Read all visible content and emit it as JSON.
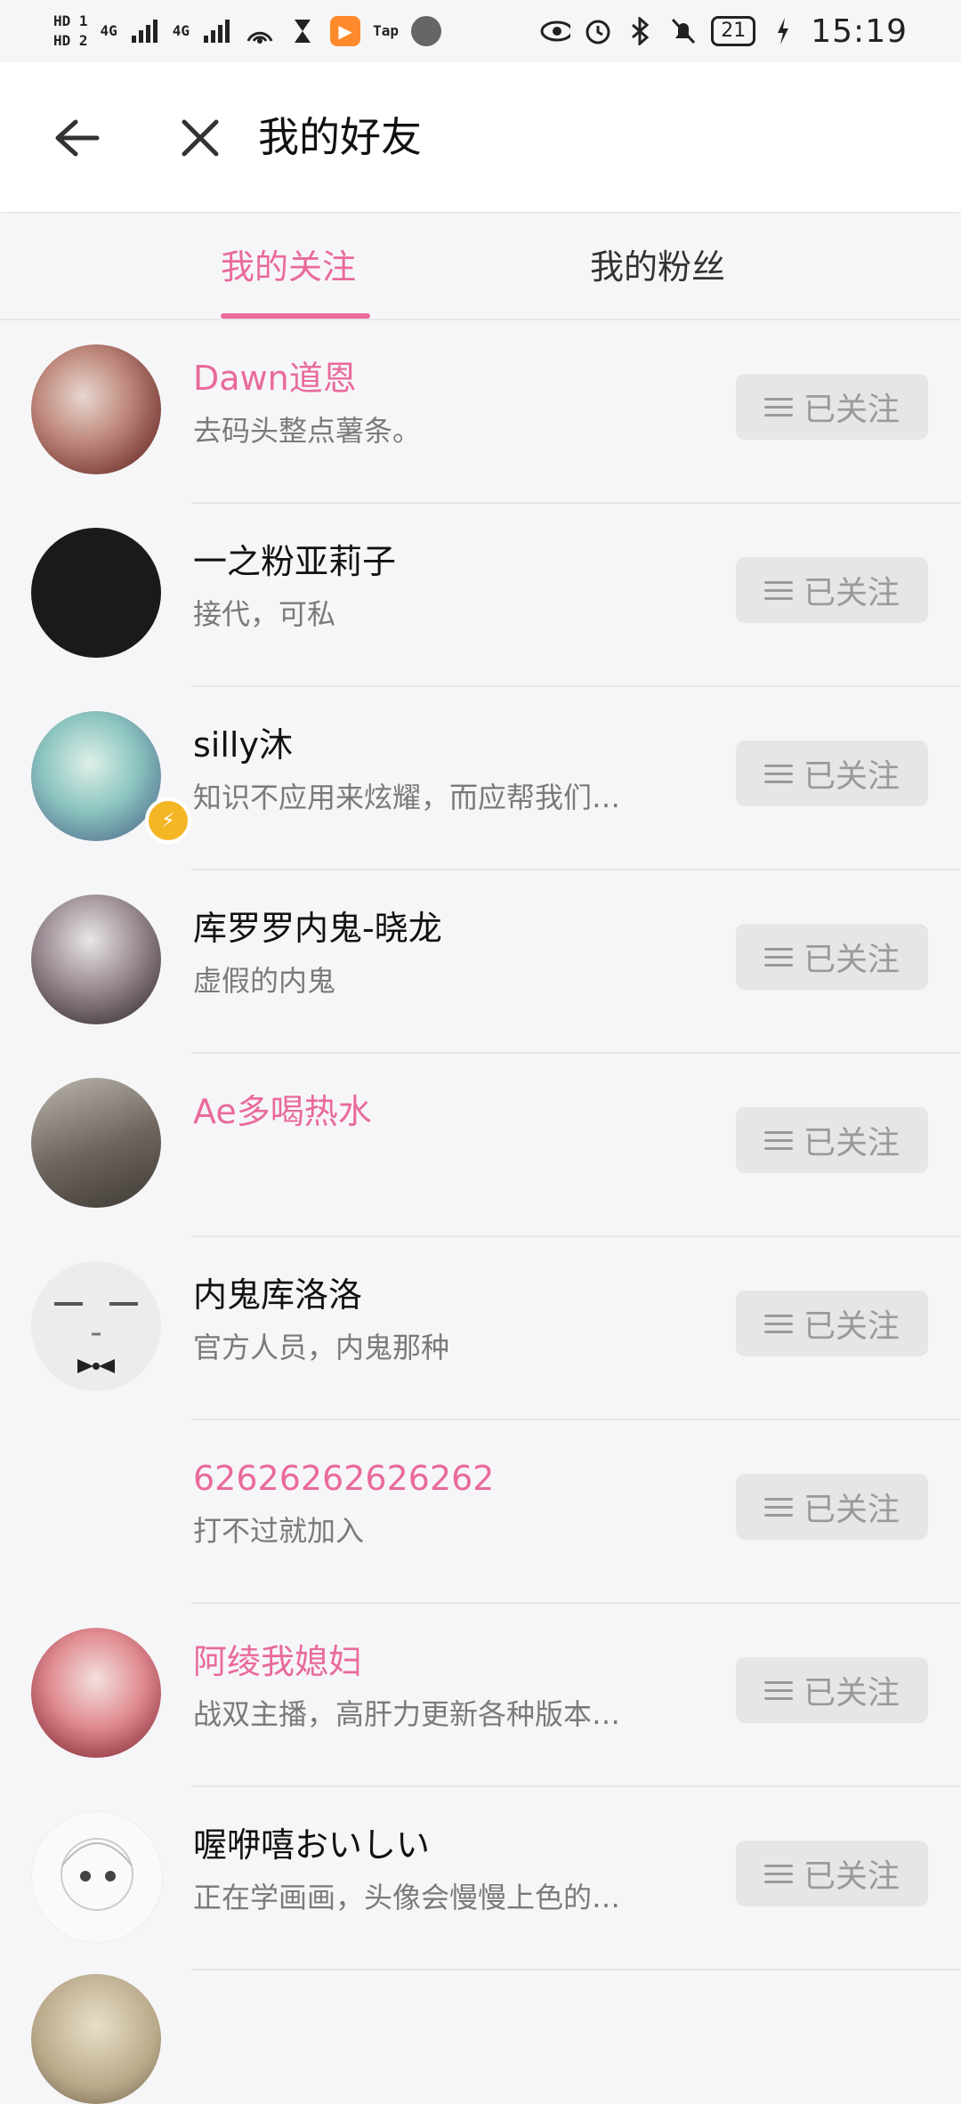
{
  "status_bar": {
    "left_chips": [
      "HD 1",
      "HD 2",
      "4G",
      "4G"
    ],
    "app_icon_label": "Tap",
    "time": "15:19",
    "battery": "21"
  },
  "header": {
    "title": "我的好友"
  },
  "tabs": [
    {
      "label": "我的关注",
      "active": true
    },
    {
      "label": "我的粉丝",
      "active": false
    }
  ],
  "follow_label": "已关注",
  "friends": [
    {
      "name": "Dawn道恩",
      "desc": "去码头整点薯条。",
      "highlight": true
    },
    {
      "name": "一之粉亚莉子",
      "desc": "接代，可私",
      "highlight": false
    },
    {
      "name": "silly沐",
      "desc": "知识不应用来炫耀，而应帮我们…",
      "highlight": false
    },
    {
      "name": "库罗罗内鬼-晓龙",
      "desc": "虚假的内鬼",
      "highlight": false
    },
    {
      "name": "Ae多喝热水",
      "desc": "",
      "highlight": true
    },
    {
      "name": "内鬼库洛洛",
      "desc": "官方人员，内鬼那种",
      "highlight": false
    },
    {
      "name": "62626262626262",
      "desc": "打不过就加入",
      "highlight": true
    },
    {
      "name": "阿绫我媳妇",
      "desc": "战双主播，高肝力更新各种版本…",
      "highlight": true
    },
    {
      "name": "喔咿嘻おいしい",
      "desc": "正在学画画，头像会慢慢上色的…",
      "highlight": false
    }
  ],
  "colors": {
    "accent": "#e96a9b",
    "button_bg": "#e6e6e6",
    "button_text": "#9a9a9a"
  }
}
